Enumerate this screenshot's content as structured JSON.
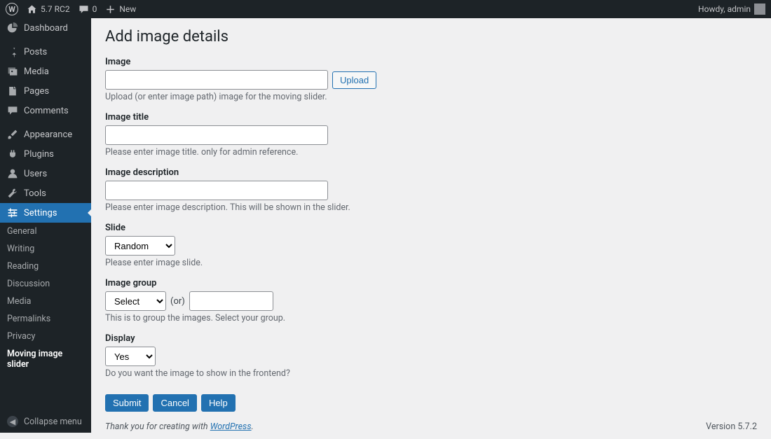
{
  "topbar": {
    "version": "5.7 RC2",
    "comments": "0",
    "new": "New",
    "howdy": "Howdy, admin"
  },
  "sidebar": {
    "main": [
      {
        "label": "Dashboard",
        "icon": "dashboard"
      },
      {
        "sep": true
      },
      {
        "label": "Posts",
        "icon": "pin"
      },
      {
        "label": "Media",
        "icon": "media"
      },
      {
        "label": "Pages",
        "icon": "pages"
      },
      {
        "label": "Comments",
        "icon": "comment"
      },
      {
        "sep": true
      },
      {
        "label": "Appearance",
        "icon": "brush"
      },
      {
        "label": "Plugins",
        "icon": "plug"
      },
      {
        "label": "Users",
        "icon": "user"
      },
      {
        "label": "Tools",
        "icon": "wrench"
      },
      {
        "label": "Settings",
        "icon": "settings",
        "active": true
      }
    ],
    "submenu": [
      {
        "label": "General"
      },
      {
        "label": "Writing"
      },
      {
        "label": "Reading"
      },
      {
        "label": "Discussion"
      },
      {
        "label": "Media"
      },
      {
        "label": "Permalinks"
      },
      {
        "label": "Privacy"
      },
      {
        "label": "Moving image slider",
        "current": true
      }
    ],
    "collapse": "Collapse menu"
  },
  "page": {
    "title": "Add image details",
    "image_label": "Image",
    "image_help": "Upload (or enter image path) image for the moving slider.",
    "upload_btn": "Upload",
    "title_label": "Image title",
    "title_help": "Please enter image title. only for admin reference.",
    "desc_label": "Image description",
    "desc_help": "Please enter image description. This will be shown in the slider.",
    "slide_label": "Slide",
    "slide_value": "Random",
    "slide_help": "Please enter image slide.",
    "group_label": "Image group",
    "group_value": "Select",
    "group_or": "(or)",
    "group_help": "This is to group the images. Select your group.",
    "display_label": "Display",
    "display_value": "Yes",
    "display_help": "Do you want the image to show in the frontend?",
    "submit": "Submit",
    "cancel": "Cancel",
    "help_btn": "Help"
  },
  "footer": {
    "thanks_pre": "Thank you for creating with ",
    "link": "WordPress",
    "thanks_post": ".",
    "version": "Version 5.7.2"
  }
}
